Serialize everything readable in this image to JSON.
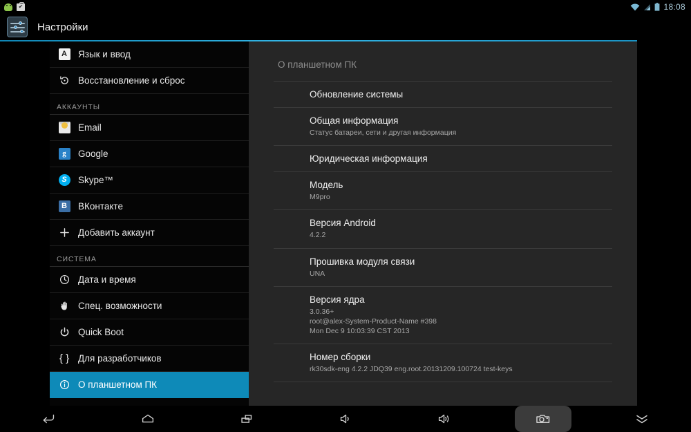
{
  "status_bar": {
    "notifications": [
      {
        "icon": "android-robot-icon",
        "name": "android-notification"
      },
      {
        "icon": "briefcase-check-icon",
        "name": "package-notification"
      }
    ],
    "wifi_icon": "wifi-icon",
    "signal_icon": "cellular-signal-icon",
    "battery_icon": "battery-icon",
    "time": "18:08"
  },
  "title_bar": {
    "app_icon": "settings-sliders-icon",
    "title": "Настройки"
  },
  "colors": {
    "accent": "#33b5e5",
    "selected_row": "#0e8ab8",
    "panel_bg": "#262626",
    "sidebar_bg": "#050505"
  },
  "sidebar": {
    "items": [
      {
        "type": "item",
        "icon": "language-icon",
        "badge": "lang",
        "glyph": "A",
        "label": "Язык и ввод",
        "selected": false
      },
      {
        "type": "item",
        "icon": "restore-icon",
        "badge": "",
        "glyph": "↺",
        "label": "Восстановление и сброс",
        "selected": false
      },
      {
        "type": "header",
        "label": "АККАУНТЫ"
      },
      {
        "type": "item",
        "icon": "email-icon",
        "badge": "email",
        "glyph": "",
        "label": "Email",
        "selected": false
      },
      {
        "type": "item",
        "icon": "google-icon",
        "badge": "google",
        "glyph": "g",
        "label": "Google",
        "selected": false
      },
      {
        "type": "item",
        "icon": "skype-icon",
        "badge": "skype",
        "glyph": "S",
        "label": "Skype™",
        "selected": false
      },
      {
        "type": "item",
        "icon": "vkontakte-icon",
        "badge": "vk",
        "glyph": "B",
        "label": "ВКонтакте",
        "selected": false
      },
      {
        "type": "item",
        "icon": "plus-icon",
        "badge": "",
        "glyph": "+",
        "label": "Добавить аккаунт",
        "selected": false
      },
      {
        "type": "header",
        "label": "СИСТЕМА"
      },
      {
        "type": "item",
        "icon": "clock-icon",
        "badge": "",
        "glyph": "◷",
        "label": "Дата и время",
        "selected": false
      },
      {
        "type": "item",
        "icon": "hand-icon",
        "badge": "",
        "glyph": "✋",
        "label": "Спец. возможности",
        "selected": false
      },
      {
        "type": "item",
        "icon": "power-icon",
        "badge": "",
        "glyph": "⏻",
        "label": "Quick Boot",
        "selected": false
      },
      {
        "type": "item",
        "icon": "braces-icon",
        "badge": "",
        "glyph": "{ }",
        "label": "Для разработчиков",
        "selected": false
      },
      {
        "type": "item",
        "icon": "info-icon",
        "badge": "",
        "glyph": "ⓘ",
        "label": "О планшетном ПК",
        "selected": true
      }
    ]
  },
  "detail": {
    "title": "О планшетном ПК",
    "preferences": [
      {
        "title": "Обновление системы",
        "sub": ""
      },
      {
        "title": "Общая информация",
        "sub": "Статус батареи, сети и другая информация"
      },
      {
        "title": "Юридическая информация",
        "sub": ""
      },
      {
        "title": "Модель",
        "sub": "M9pro"
      },
      {
        "title": "Версия Android",
        "sub": "4.2.2"
      },
      {
        "title": "Прошивка модуля связи",
        "sub": "UNA"
      },
      {
        "title": "Версия ядра",
        "sub": "3.0.36+\nroot@alex-System-Product-Name #398\nMon Dec 9 10:03:39 CST 2013"
      },
      {
        "title": "Номер сборки",
        "sub": "rk30sdk-eng 4.2.2 JDQ39 eng.root.20131209.100724 test-keys"
      }
    ]
  },
  "nav_bar": {
    "buttons": [
      {
        "icon": "back-icon",
        "label": "Назад",
        "highlight": false
      },
      {
        "icon": "home-icon",
        "label": "Главный экран",
        "highlight": false
      },
      {
        "icon": "recent-apps-icon",
        "label": "Последние приложения",
        "highlight": false
      },
      {
        "icon": "volume-down-icon",
        "label": "Тише",
        "highlight": false
      },
      {
        "icon": "volume-up-icon",
        "label": "Громче",
        "highlight": false
      },
      {
        "icon": "screenshot-camera-icon",
        "label": "Снимок экрана",
        "highlight": true
      },
      {
        "icon": "chevron-double-down-icon",
        "label": "Скрыть панель",
        "highlight": false
      }
    ]
  }
}
